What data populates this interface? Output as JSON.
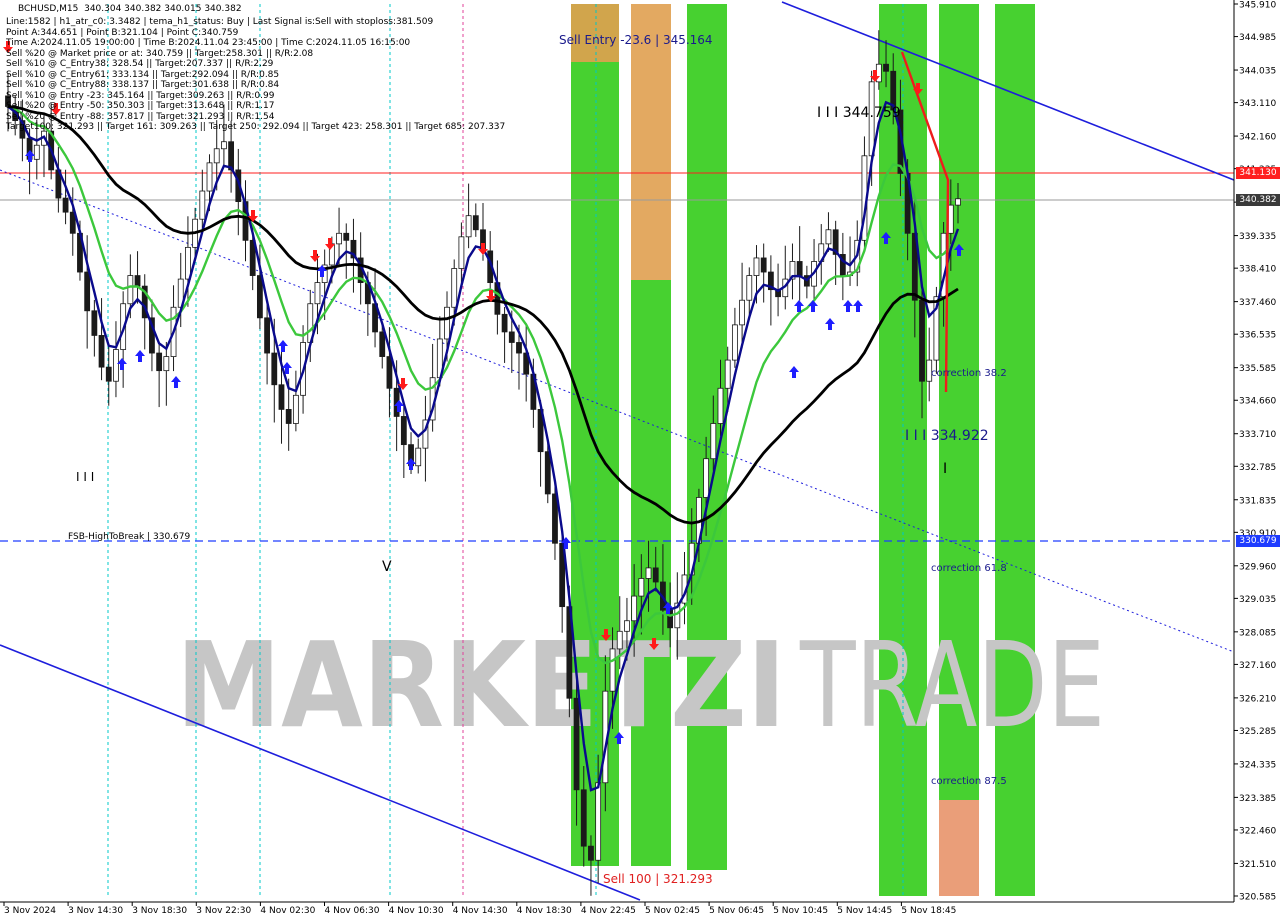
{
  "header": {
    "symbol_line": "BCHUSD,M15  340.304 340.382 340.015 340.382",
    "info_lines": [
      "Line:1582 | h1_atr_c0: 3.3482 | tema_h1_status: Buy | Last Signal is:Sell with stoploss:381.509",
      "Point A:344.651 | Point B:321.104 | Point C:340.759",
      "Time A:2024.11.05 19:00:00 | Time B:2024.11.04 23:45:00 | Time C:2024.11.05 16:15:00",
      "Sell %20 @ Market price or at: 340.759 || Target:258.301 || R/R:2.08",
      "Sell %10 @ C_Entry38: 328.54 || Target:207.337 || R/R:2.29",
      "Sell %10 @ C_Entry61: 333.134 || Target:292.094 || R/R:0.85",
      "Sell %10 @ C_Entry88: 338.137 || Target:301.638 || R/R:0.84",
      "Sell %10 @ Entry -23: 345.164 || Target:309.263 || R/R:0.99",
      "Sell %20 @ Entry -50: 350.303 || Target:313.648 || R/R:1.17",
      "Sell %20 @ Entry -88: 357.817 || Target:321.293 || R/R:1.54",
      "Target100: 321.293 || Target 161: 309.263 || Target 250: 292.094 || Target 423: 258.301 || Target 685: 207.337"
    ]
  },
  "watermark": {
    "dark": "MARKETZI",
    "light": "TRADE"
  },
  "labels": {
    "sell_entry": "Sell Entry -23.6 | 345.164",
    "sell_100": "Sell 100 | 321.293",
    "point_a_label": "I I I 344.759",
    "point_c_label": "I I I 334.922",
    "fsb": "FSB-HighToBreak | 330.679",
    "correction_38": "correction 38.2",
    "correction_61": "correction 61.8",
    "correction_87": "correction 87.5",
    "wave_iii": "I I I",
    "wave_v": "V",
    "wave_i": "I"
  },
  "price_boxes": {
    "red": {
      "value": "341.130",
      "color": "#ff1f1f"
    },
    "current": {
      "value": "340.382",
      "color": "#3a3a3a"
    },
    "fsb": {
      "value": "330.679",
      "color": "#1e3cff"
    }
  },
  "colors": {
    "green_band": "#33cc1a",
    "orange_band": "#e0a050",
    "salmon_band": "#e8936a",
    "ma_black": "#000000",
    "ma_green": "#3cc83c",
    "ma_navy": "#0a0a8c",
    "channel_blue": "#1e1edc",
    "up_arrow": "#1e1eff",
    "down_arrow": "#ff1a1a"
  },
  "chart_data": {
    "type": "candlestick",
    "symbol": "BCHUSD",
    "timeframe": "M15",
    "y_ticks": [
      "345.910",
      "344.985",
      "344.035",
      "343.110",
      "342.160",
      "341.235",
      "340.285",
      "339.335",
      "338.410",
      "337.460",
      "336.535",
      "335.585",
      "334.660",
      "333.710",
      "332.785",
      "331.835",
      "330.910",
      "329.960",
      "329.035",
      "328.085",
      "327.160",
      "326.210",
      "325.285",
      "324.335",
      "323.385",
      "322.460",
      "321.510",
      "320.585"
    ],
    "x_ticks": [
      "3 Nov 2024",
      "3 Nov 14:30",
      "3 Nov 18:30",
      "3 Nov 22:30",
      "4 Nov 02:30",
      "4 Nov 06:30",
      "4 Nov 10:30",
      "4 Nov 14:30",
      "4 Nov 18:30",
      "4 Nov 22:45",
      "5 Nov 02:45",
      "5 Nov 06:45",
      "5 Nov 10:45",
      "5 Nov 14:45",
      "5 Nov 18:45"
    ],
    "ylim": [
      320.585,
      345.91
    ],
    "closes": [
      343.0,
      342.6,
      342.1,
      341.5,
      341.9,
      342.3,
      341.2,
      340.4,
      340.0,
      339.4,
      338.3,
      337.2,
      336.5,
      335.6,
      335.2,
      336.1,
      337.4,
      338.2,
      337.9,
      337.0,
      336.0,
      335.5,
      335.9,
      337.3,
      338.1,
      339.0,
      339.8,
      340.6,
      341.4,
      341.8,
      342.0,
      341.2,
      340.3,
      339.2,
      338.2,
      337.0,
      336.0,
      335.1,
      334.4,
      334.0,
      334.8,
      336.3,
      337.4,
      338.0,
      338.5,
      339.1,
      339.4,
      339.2,
      338.7,
      338.0,
      337.4,
      336.6,
      335.9,
      335.0,
      334.2,
      333.4,
      332.8,
      333.3,
      334.1,
      335.3,
      336.4,
      337.3,
      338.4,
      339.3,
      339.9,
      339.5,
      338.9,
      338.0,
      337.1,
      336.6,
      336.3,
      336.0,
      335.4,
      334.4,
      333.2,
      332.0,
      330.6,
      328.8,
      326.2,
      323.6,
      322.0,
      321.6,
      323.8,
      326.4,
      327.6,
      328.1,
      328.4,
      329.1,
      329.6,
      329.9,
      329.5,
      328.7,
      328.2,
      328.9,
      329.7,
      330.6,
      331.9,
      333.0,
      334.0,
      335.0,
      335.8,
      336.8,
      337.5,
      338.2,
      338.7,
      338.3,
      337.8,
      337.6,
      338.1,
      338.6,
      338.2,
      337.9,
      338.6,
      339.1,
      339.5,
      338.8,
      338.2,
      338.3,
      339.2,
      341.6,
      343.7,
      344.2,
      344.0,
      342.9,
      341.1,
      339.4,
      337.5,
      335.2,
      335.8,
      337.6,
      339.4,
      340.2,
      340.38
    ]
  }
}
